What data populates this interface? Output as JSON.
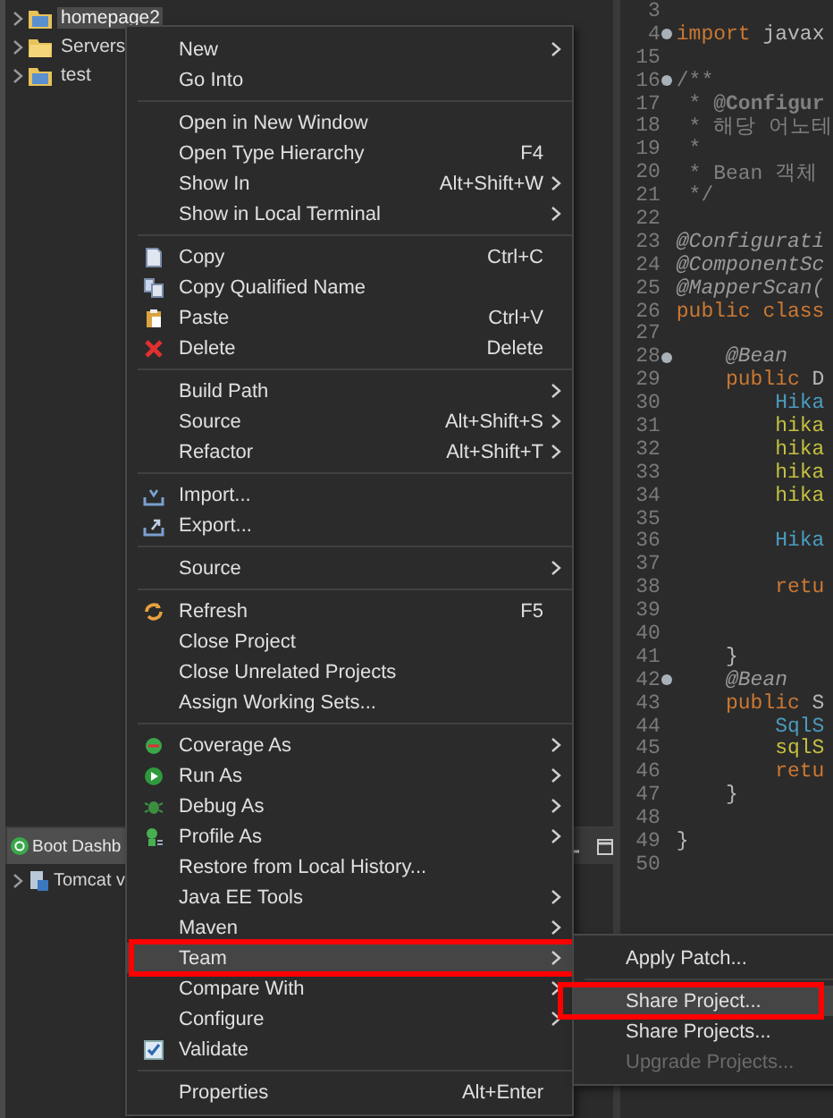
{
  "explorer": {
    "items": [
      {
        "label": "homepage2",
        "selected": true
      },
      {
        "label": "Servers",
        "selected": false
      },
      {
        "label": "test",
        "selected": false
      }
    ]
  },
  "bottom_panel": {
    "tabs": [
      {
        "label": "Boot Dashb",
        "selected": true
      }
    ],
    "rows": [
      {
        "label": "Tomcat v"
      }
    ]
  },
  "editor": {
    "lines": [
      {
        "number": "3"
      },
      {
        "number": "4",
        "fold": true,
        "segments": [
          {
            "text": "import",
            "kind": "keyword"
          },
          {
            "text": " javax",
            "kind": "plain"
          }
        ]
      },
      {
        "number": "15"
      },
      {
        "number": "16",
        "fold": true,
        "segments": [
          {
            "text": "/**",
            "kind": "comment"
          }
        ]
      },
      {
        "number": "17",
        "segments": [
          {
            "text": " * ",
            "kind": "comment"
          },
          {
            "text": "@Configur",
            "kind": "doctag"
          }
        ]
      },
      {
        "number": "18",
        "segments": [
          {
            "text": " * 해당 어노테",
            "kind": "comment"
          }
        ]
      },
      {
        "number": "19",
        "segments": [
          {
            "text": " *",
            "kind": "comment"
          }
        ]
      },
      {
        "number": "20",
        "segments": [
          {
            "text": " * Bean 객체",
            "kind": "comment"
          }
        ]
      },
      {
        "number": "21",
        "segments": [
          {
            "text": " */",
            "kind": "comment"
          }
        ]
      },
      {
        "number": "22"
      },
      {
        "number": "23",
        "segments": [
          {
            "text": "@Configurati",
            "kind": "annotation"
          }
        ]
      },
      {
        "number": "24",
        "segments": [
          {
            "text": "@ComponentSc",
            "kind": "annotation"
          }
        ]
      },
      {
        "number": "25",
        "segments": [
          {
            "text": "@MapperScan(",
            "kind": "annotation"
          }
        ]
      },
      {
        "number": "26",
        "segments": [
          {
            "text": "public class",
            "kind": "keyword"
          }
        ]
      },
      {
        "number": "27"
      },
      {
        "number": "28",
        "fold": true,
        "segments": [
          {
            "text": "    @Bean",
            "kind": "annotation"
          }
        ]
      },
      {
        "number": "29",
        "segments": [
          {
            "text": "    public",
            "kind": "keyword"
          },
          {
            "text": " D",
            "kind": "plain"
          }
        ]
      },
      {
        "number": "30",
        "segments": [
          {
            "text": "        Hika",
            "kind": "type"
          }
        ]
      },
      {
        "number": "31",
        "segments": [
          {
            "text": "        hika",
            "kind": "variable"
          }
        ]
      },
      {
        "number": "32",
        "segments": [
          {
            "text": "        hika",
            "kind": "variable"
          }
        ]
      },
      {
        "number": "33",
        "segments": [
          {
            "text": "        hika",
            "kind": "variable"
          }
        ]
      },
      {
        "number": "34",
        "segments": [
          {
            "text": "        hika",
            "kind": "variable"
          }
        ]
      },
      {
        "number": "35"
      },
      {
        "number": "36",
        "segments": [
          {
            "text": "        Hika",
            "kind": "type"
          }
        ]
      },
      {
        "number": "37"
      },
      {
        "number": "38",
        "segments": [
          {
            "text": "        retu",
            "kind": "keyword"
          }
        ]
      },
      {
        "number": "39"
      },
      {
        "number": "40"
      },
      {
        "number": "41",
        "segments": [
          {
            "text": "    }",
            "kind": "plain"
          }
        ]
      },
      {
        "number": "42",
        "fold": true,
        "segments": [
          {
            "text": "    @Bean",
            "kind": "annotation"
          }
        ]
      },
      {
        "number": "43",
        "segments": [
          {
            "text": "    public",
            "kind": "keyword"
          },
          {
            "text": " S",
            "kind": "plain"
          }
        ]
      },
      {
        "number": "44",
        "segments": [
          {
            "text": "        SqlS",
            "kind": "type"
          }
        ]
      },
      {
        "number": "45",
        "segments": [
          {
            "text": "        sqlS",
            "kind": "variable"
          }
        ]
      },
      {
        "number": "46",
        "segments": [
          {
            "text": "        retu",
            "kind": "keyword"
          }
        ]
      },
      {
        "number": "47",
        "segments": [
          {
            "text": "    }",
            "kind": "plain"
          }
        ]
      },
      {
        "number": "48"
      },
      {
        "number": "49",
        "segments": [
          {
            "text": "}",
            "kind": "plain"
          }
        ]
      },
      {
        "number": "50"
      }
    ]
  },
  "context_menu": {
    "items": [
      {
        "kind": "item",
        "label": "New",
        "submenu": true,
        "selected": false
      },
      {
        "kind": "item",
        "label": "Go Into",
        "selected": false
      },
      {
        "kind": "separator"
      },
      {
        "kind": "item",
        "label": "Open in New Window",
        "selected": false
      },
      {
        "kind": "item",
        "label": "Open Type Hierarchy",
        "shortcut": "F4",
        "selected": false
      },
      {
        "kind": "item",
        "label": "Show In",
        "shortcut": "Alt+Shift+W",
        "submenu": true,
        "selected": false
      },
      {
        "kind": "item",
        "label": "Show in Local Terminal",
        "submenu": true,
        "selected": false
      },
      {
        "kind": "separator"
      },
      {
        "kind": "item",
        "label": "Copy",
        "shortcut": "Ctrl+C",
        "selected": false
      },
      {
        "kind": "item",
        "label": "Copy Qualified Name",
        "selected": false
      },
      {
        "kind": "item",
        "label": "Paste",
        "shortcut": "Ctrl+V",
        "selected": false
      },
      {
        "kind": "item",
        "label": "Delete",
        "shortcut": "Delete",
        "selected": false
      },
      {
        "kind": "separator"
      },
      {
        "kind": "item",
        "label": "Build Path",
        "submenu": true,
        "selected": false
      },
      {
        "kind": "item",
        "label": "Source",
        "shortcut": "Alt+Shift+S",
        "submenu": true,
        "selected": false
      },
      {
        "kind": "item",
        "label": "Refactor",
        "shortcut": "Alt+Shift+T",
        "submenu": true,
        "selected": false
      },
      {
        "kind": "separator"
      },
      {
        "kind": "item",
        "label": "Import...",
        "selected": false
      },
      {
        "kind": "item",
        "label": "Export...",
        "selected": false
      },
      {
        "kind": "separator"
      },
      {
        "kind": "item",
        "label": "Source",
        "submenu": true,
        "selected": false
      },
      {
        "kind": "separator"
      },
      {
        "kind": "item",
        "label": "Refresh",
        "shortcut": "F5",
        "selected": false
      },
      {
        "kind": "item",
        "label": "Close Project",
        "selected": false
      },
      {
        "kind": "item",
        "label": "Close Unrelated Projects",
        "selected": false
      },
      {
        "kind": "item",
        "label": "Assign Working Sets...",
        "selected": false
      },
      {
        "kind": "separator"
      },
      {
        "kind": "item",
        "label": "Coverage As",
        "submenu": true,
        "selected": false
      },
      {
        "kind": "item",
        "label": "Run As",
        "submenu": true,
        "selected": false
      },
      {
        "kind": "item",
        "label": "Debug As",
        "submenu": true,
        "selected": false
      },
      {
        "kind": "item",
        "label": "Profile As",
        "submenu": true,
        "selected": false
      },
      {
        "kind": "item",
        "label": "Restore from Local History...",
        "selected": false
      },
      {
        "kind": "item",
        "label": "Java EE Tools",
        "submenu": true,
        "selected": false
      },
      {
        "kind": "item",
        "label": "Maven",
        "submenu": true,
        "selected": false
      },
      {
        "kind": "item",
        "label": "Team",
        "submenu": true,
        "selected": true,
        "boxed": true
      },
      {
        "kind": "item",
        "label": "Compare With",
        "submenu": true,
        "selected": false
      },
      {
        "kind": "item",
        "label": "Configure",
        "submenu": true,
        "selected": false
      },
      {
        "kind": "item",
        "label": "Validate",
        "selected": false
      },
      {
        "kind": "separator"
      },
      {
        "kind": "item",
        "label": "Properties",
        "shortcut": "Alt+Enter",
        "selected": false
      }
    ]
  },
  "team_submenu": {
    "items": [
      {
        "kind": "item",
        "label": "Apply Patch...",
        "selected": false,
        "disabled": false
      },
      {
        "kind": "separator"
      },
      {
        "kind": "item",
        "label": "Share Project...",
        "selected": true,
        "disabled": false,
        "boxed": true
      },
      {
        "kind": "item",
        "label": "Share Projects...",
        "selected": false,
        "disabled": false
      },
      {
        "kind": "item",
        "label": "Upgrade Projects...",
        "selected": false,
        "disabled": true
      }
    ]
  }
}
